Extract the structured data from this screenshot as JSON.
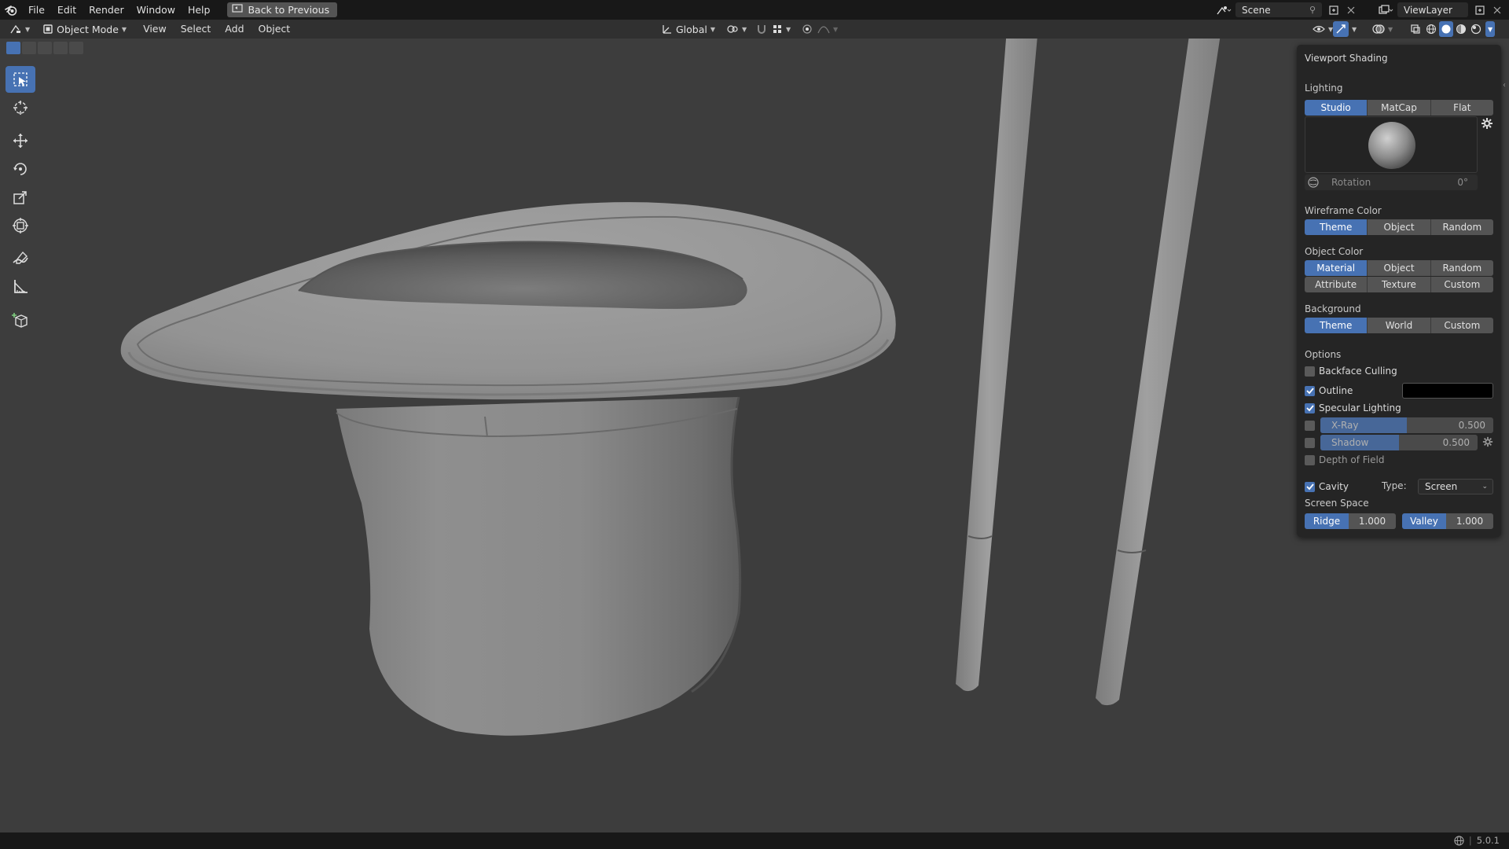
{
  "topbar": {
    "menus": [
      "File",
      "Edit",
      "Render",
      "Window",
      "Help"
    ],
    "back_label": "Back to Previous",
    "scene_name": "Scene",
    "view_layer": "ViewLayer"
  },
  "header": {
    "mode": "Object Mode",
    "menus": [
      "View",
      "Select",
      "Add",
      "Object"
    ],
    "orientation": "Global"
  },
  "shading_panel": {
    "title": "Viewport Shading",
    "lighting_label": "Lighting",
    "lighting_options": [
      "Studio",
      "MatCap",
      "Flat"
    ],
    "lighting_selected": "Studio",
    "rotation_label": "Rotation",
    "rotation_value": "0°",
    "wireframe_label": "Wireframe Color",
    "wireframe_options": [
      "Theme",
      "Object",
      "Random"
    ],
    "object_color_label": "Object Color",
    "object_color_options_row1": [
      "Material",
      "Object",
      "Random"
    ],
    "object_color_options_row2": [
      "Attribute",
      "Texture",
      "Custom"
    ],
    "background_label": "Background",
    "background_options": [
      "Theme",
      "World",
      "Custom"
    ],
    "options_label": "Options",
    "backface_culling": "Backface Culling",
    "outline": "Outline",
    "specular_lighting": "Specular Lighting",
    "xray_label": "X-Ray",
    "xray_value": "0.500",
    "xray_fraction": 0.5,
    "shadow_label": "Shadow",
    "shadow_value": "0.500",
    "shadow_fraction": 0.5,
    "depth_of_field": "Depth of Field",
    "cavity": "Cavity",
    "type_label": "Type:",
    "type_value": "Screen",
    "screen_space_label": "Screen Space",
    "ridge_label": "Ridge",
    "ridge_value": "1.000",
    "valley_label": "Valley",
    "valley_value": "1.000"
  },
  "statusbar": {
    "version": "5.0.1"
  },
  "colors": {
    "accent": "#4772b3",
    "background": "#3d3d3d",
    "panel": "#252525"
  }
}
